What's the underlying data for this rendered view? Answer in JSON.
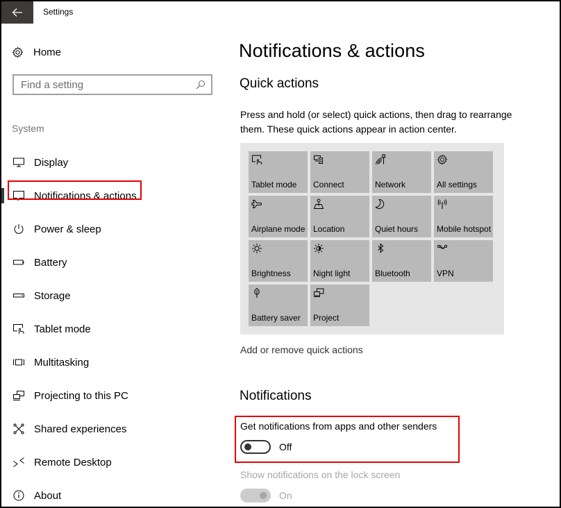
{
  "window": {
    "title": "Settings",
    "back_icon": "arrow-left-icon"
  },
  "sidebar": {
    "home_label": "Home",
    "home_icon": "gear-icon",
    "search_placeholder": "Find a setting",
    "search_icon": "search-icon",
    "section_label": "System",
    "items": [
      {
        "label": "Display",
        "icon": "monitor-icon"
      },
      {
        "label": "Notifications & actions",
        "icon": "speech-bubble-icon",
        "active": true,
        "highlighted": true
      },
      {
        "label": "Power & sleep",
        "icon": "power-icon"
      },
      {
        "label": "Battery",
        "icon": "battery-icon"
      },
      {
        "label": "Storage",
        "icon": "storage-icon"
      },
      {
        "label": "Tablet mode",
        "icon": "tablet-mode-icon"
      },
      {
        "label": "Multitasking",
        "icon": "multitasking-icon"
      },
      {
        "label": "Projecting to this PC",
        "icon": "projecting-icon"
      },
      {
        "label": "Shared experiences",
        "icon": "shared-experiences-icon"
      },
      {
        "label": "Remote Desktop",
        "icon": "remote-desktop-icon"
      },
      {
        "label": "About",
        "icon": "info-icon"
      }
    ]
  },
  "main": {
    "title": "Notifications & actions",
    "quick_actions": {
      "heading": "Quick actions",
      "description": "Press and hold (or select) quick actions, then drag to rearrange them. These quick actions appear in action center.",
      "tiles": [
        {
          "label": "Tablet mode",
          "icon": "tablet-mode-icon"
        },
        {
          "label": "Connect",
          "icon": "connect-icon"
        },
        {
          "label": "Network",
          "icon": "network-icon"
        },
        {
          "label": "All settings",
          "icon": "gear-icon"
        },
        {
          "label": "Airplane mode",
          "icon": "airplane-icon"
        },
        {
          "label": "Location",
          "icon": "location-icon"
        },
        {
          "label": "Quiet hours",
          "icon": "moon-icon"
        },
        {
          "label": "Mobile hotspot",
          "icon": "hotspot-icon"
        },
        {
          "label": "Brightness",
          "icon": "sun-icon"
        },
        {
          "label": "Night light",
          "icon": "night-light-icon"
        },
        {
          "label": "Bluetooth",
          "icon": "bluetooth-icon"
        },
        {
          "label": "VPN",
          "icon": "vpn-icon"
        },
        {
          "label": "Battery saver",
          "icon": "leaf-icon"
        },
        {
          "label": "Project",
          "icon": "project-icon"
        }
      ],
      "link": "Add or remove quick actions"
    },
    "notifications": {
      "heading": "Notifications",
      "settings": [
        {
          "label": "Get notifications from apps and other senders",
          "state": "Off",
          "enabled": true,
          "highlighted": true
        },
        {
          "label": "Show notifications on the lock screen",
          "state": "On",
          "enabled": false
        }
      ]
    }
  },
  "colors": {
    "highlight": "#e50000",
    "titlebar_back": "#3e3a39",
    "tile_bg": "#b9b9b9",
    "panel_bg": "#e6e6e6"
  }
}
